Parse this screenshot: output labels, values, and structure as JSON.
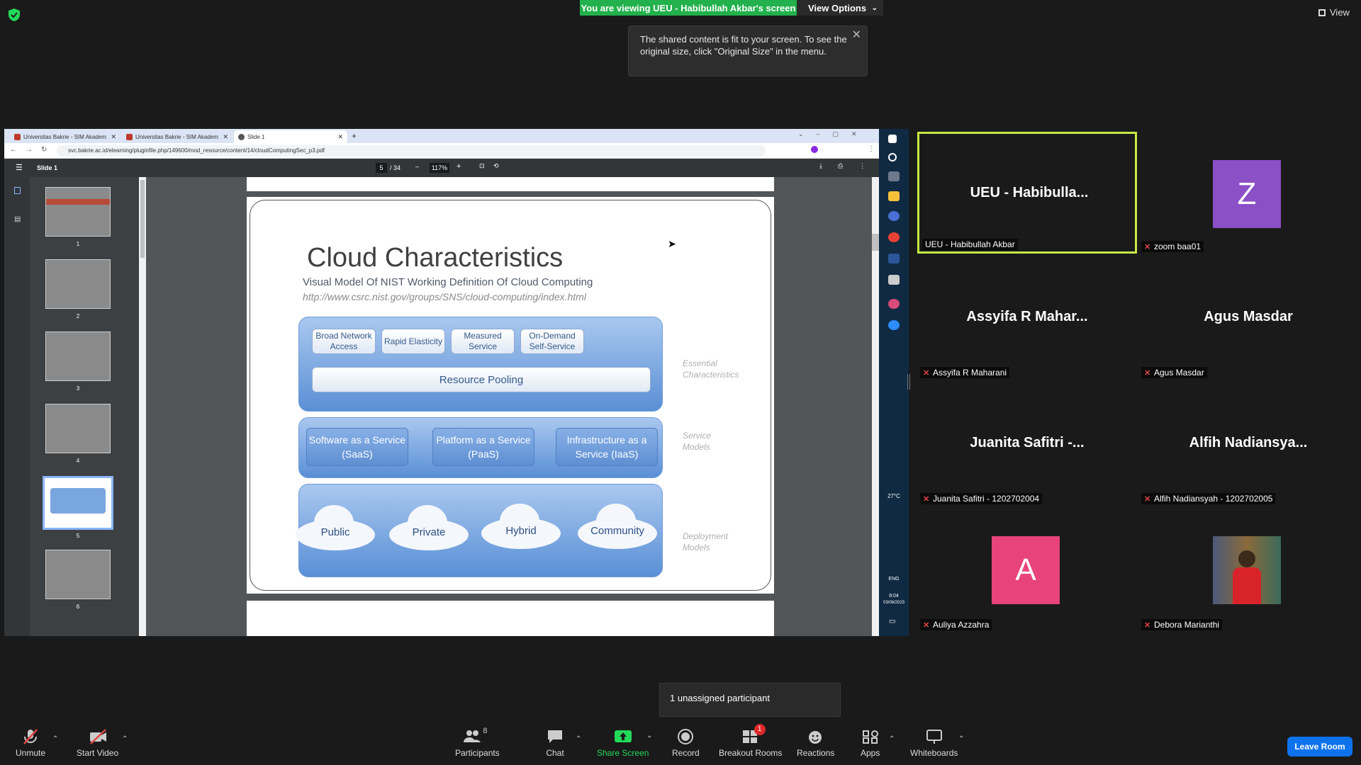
{
  "zoom": {
    "viewing_banner": "You are viewing UEU - Habibullah Akbar's screen",
    "view_options": "View Options",
    "tooltip": "The shared content is fit to your screen. To see the original size, click \"Original Size\" in the menu.",
    "view_button": "View",
    "unassigned": "1 unassigned participant",
    "toolbar": {
      "unmute": "Unmute",
      "start_video": "Start Video",
      "participants": "Participants",
      "participants_count": "8",
      "chat": "Chat",
      "share_screen": "Share Screen",
      "record": "Record",
      "breakout_rooms": "Breakout Rooms",
      "breakout_badge": "1",
      "reactions": "Reactions",
      "apps": "Apps",
      "whiteboards": "Whiteboards",
      "leave": "Leave Room"
    }
  },
  "browser": {
    "tabs": [
      {
        "title": "Universitas Bakrie - SIM Akadem"
      },
      {
        "title": "Universitas Bakrie - SIM Akadem"
      },
      {
        "title": "Slide 1"
      }
    ],
    "url": "svc.bakrie.ac.id/elearning/pluginfile.php/149600/mod_resource/content/14/cloudComputingSec_p3.pdf"
  },
  "pdf": {
    "doc_title": "Slide 1",
    "current_page": "5",
    "total_pages": "/ 34",
    "zoom": "117%",
    "thumb_numbers": [
      "1",
      "2",
      "3",
      "4",
      "5",
      "6"
    ]
  },
  "slide": {
    "title": "Cloud Characteristics",
    "subtitle": "Visual Model Of NIST Working Definition Of Cloud Computing",
    "url": "http://www.csrc.nist.gov/groups/SNS/cloud-computing/index.html",
    "essential": [
      "Broad Network Access",
      "Rapid Elasticity",
      "Measured Service",
      "On-Demand Self-Service"
    ],
    "pooling": "Resource Pooling",
    "services": [
      "Software as a Service (SaaS)",
      "Platform as a Service (PaaS)",
      "Infrastructure as a Service (IaaS)"
    ],
    "deployments": [
      "Public",
      "Private",
      "Hybrid",
      "Community"
    ],
    "labels": {
      "essential": "Essential Characteristics",
      "service": "Service Models",
      "deployment": "Deployment Models"
    }
  },
  "taskbar": {
    "weather": "27°C",
    "lang": "ENG",
    "time": "8:04",
    "date": "03/06/2023"
  },
  "participants": [
    {
      "name": "UEU - Habibulla...",
      "label": "UEU - Habibullah Akbar",
      "muted": false
    },
    {
      "initial": "Z",
      "label": "zoom baa01",
      "muted": true,
      "color": "#8b4fc6"
    },
    {
      "name": "Assyifa R Mahar...",
      "label": "Assyifa R Maharani",
      "muted": true
    },
    {
      "name": "Agus Masdar",
      "label": "Agus Masdar",
      "muted": true
    },
    {
      "name": "Juanita Safitri -...",
      "label": "Juanita Safitri - 1202702004",
      "muted": true
    },
    {
      "name": "Alfih Nadiansya...",
      "label": "Alfih Nadiansyah - 1202702005",
      "muted": true
    },
    {
      "initial": "A",
      "label": "Auliya Azzahra",
      "muted": true,
      "color": "#e8437a"
    },
    {
      "label": "Debora Marianthi",
      "muted": true
    }
  ]
}
